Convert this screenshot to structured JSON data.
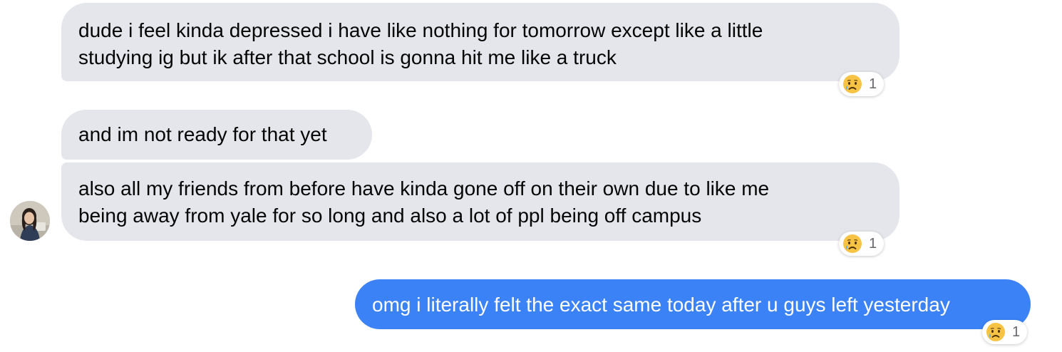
{
  "conversation": {
    "messages": [
      {
        "sender": "other",
        "lines": [
          "dude i feel kinda depressed i have like nothing for tomorrow except like a little",
          "studying ig but ik after that school is gonna hit me like a truck"
        ],
        "reaction": {
          "icon": "crying-face-icon",
          "count": "1"
        }
      },
      {
        "sender": "other",
        "lines": [
          "and im not ready for that yet"
        ]
      },
      {
        "sender": "other",
        "lines": [
          "also all my friends from before have kinda gone off on their own due to like me",
          "being away from yale for so long and also a lot of ppl being off campus"
        ],
        "reaction": {
          "icon": "crying-face-icon",
          "count": "1"
        }
      },
      {
        "sender": "me",
        "lines": [
          "omg i literally felt the exact same today after u guys left yesterday"
        ],
        "reaction": {
          "icon": "crying-face-icon",
          "count": "1"
        }
      }
    ],
    "avatar_icon": "contact-avatar"
  },
  "colors": {
    "incoming_bubble": "#e4e6eb",
    "outgoing_bubble": "#3a82f6",
    "reaction_count": "#65676b"
  }
}
